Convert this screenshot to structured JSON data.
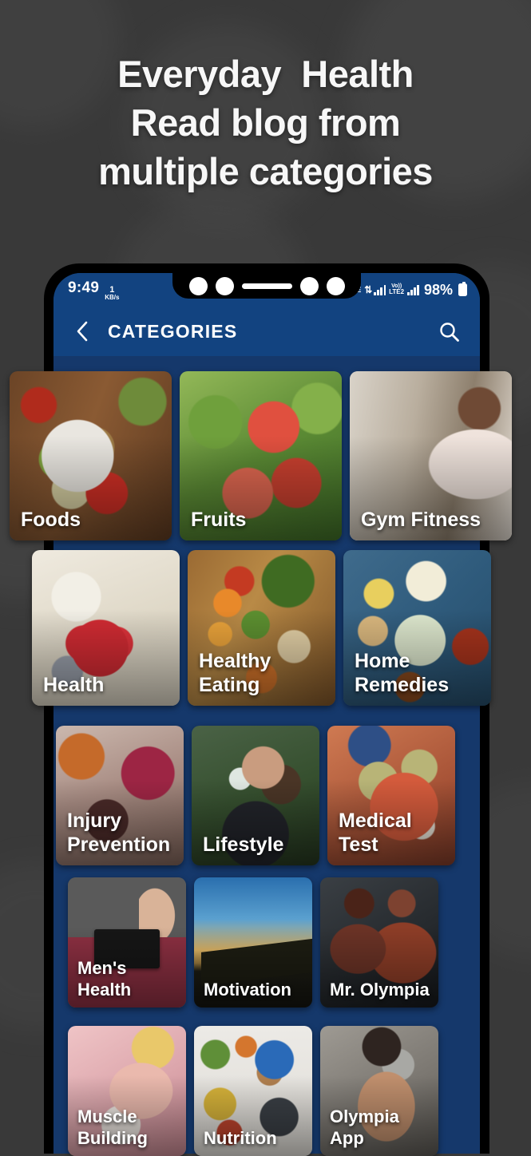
{
  "headline": {
    "lines": [
      "Everyday  Health",
      "Read blog from",
      "multiple categories"
    ]
  },
  "colors": {
    "page_background": "#393939",
    "appbar_blue": "#124380",
    "screen_blue": "#15386b",
    "text_white": "#ffffff"
  },
  "statusbar": {
    "time": "9:49",
    "data_rate_value": "1",
    "data_rate_unit": "KB/s",
    "network_label_1": "LTE",
    "network_volte": "Vo))",
    "network_label_2": "LTE2",
    "transfer_arrows": "⇅",
    "battery_percent": "98%"
  },
  "appbar": {
    "back_icon": "chevron-left-icon",
    "title": "CATEGORIES",
    "search_icon": "search-icon"
  },
  "grid": {
    "rows": [
      {
        "cards": [
          {
            "label": "Foods",
            "art": "a-foods"
          },
          {
            "label": "Fruits",
            "art": "a-fruits"
          },
          {
            "label": "Gym Fitness",
            "art": "a-gym"
          }
        ]
      },
      {
        "cards": [
          {
            "label": "Health",
            "art": "a-health"
          },
          {
            "label": "Healthy\nEating",
            "art": "a-eating"
          },
          {
            "label": "Home\nRemedies",
            "art": "a-remedies"
          }
        ]
      },
      {
        "cards": [
          {
            "label": "Injury\nPrevention",
            "art": "a-injury"
          },
          {
            "label": "Lifestyle",
            "art": "a-lifestyle"
          },
          {
            "label": "Medical Test",
            "art": "a-medical"
          }
        ]
      },
      {
        "cards": [
          {
            "label": "Men's\nHealth",
            "art": "a-mens"
          },
          {
            "label": "Motivation",
            "art": "a-motivation"
          },
          {
            "label": "Mr. Olympia",
            "art": "a-olympia"
          }
        ]
      },
      {
        "cards": [
          {
            "label": "Muscle\nBuilding",
            "art": "a-muscle"
          },
          {
            "label": "Nutrition",
            "art": "a-nutrition"
          },
          {
            "label": "Olympia\nApp",
            "art": "a-olympiaapp"
          }
        ]
      }
    ]
  }
}
